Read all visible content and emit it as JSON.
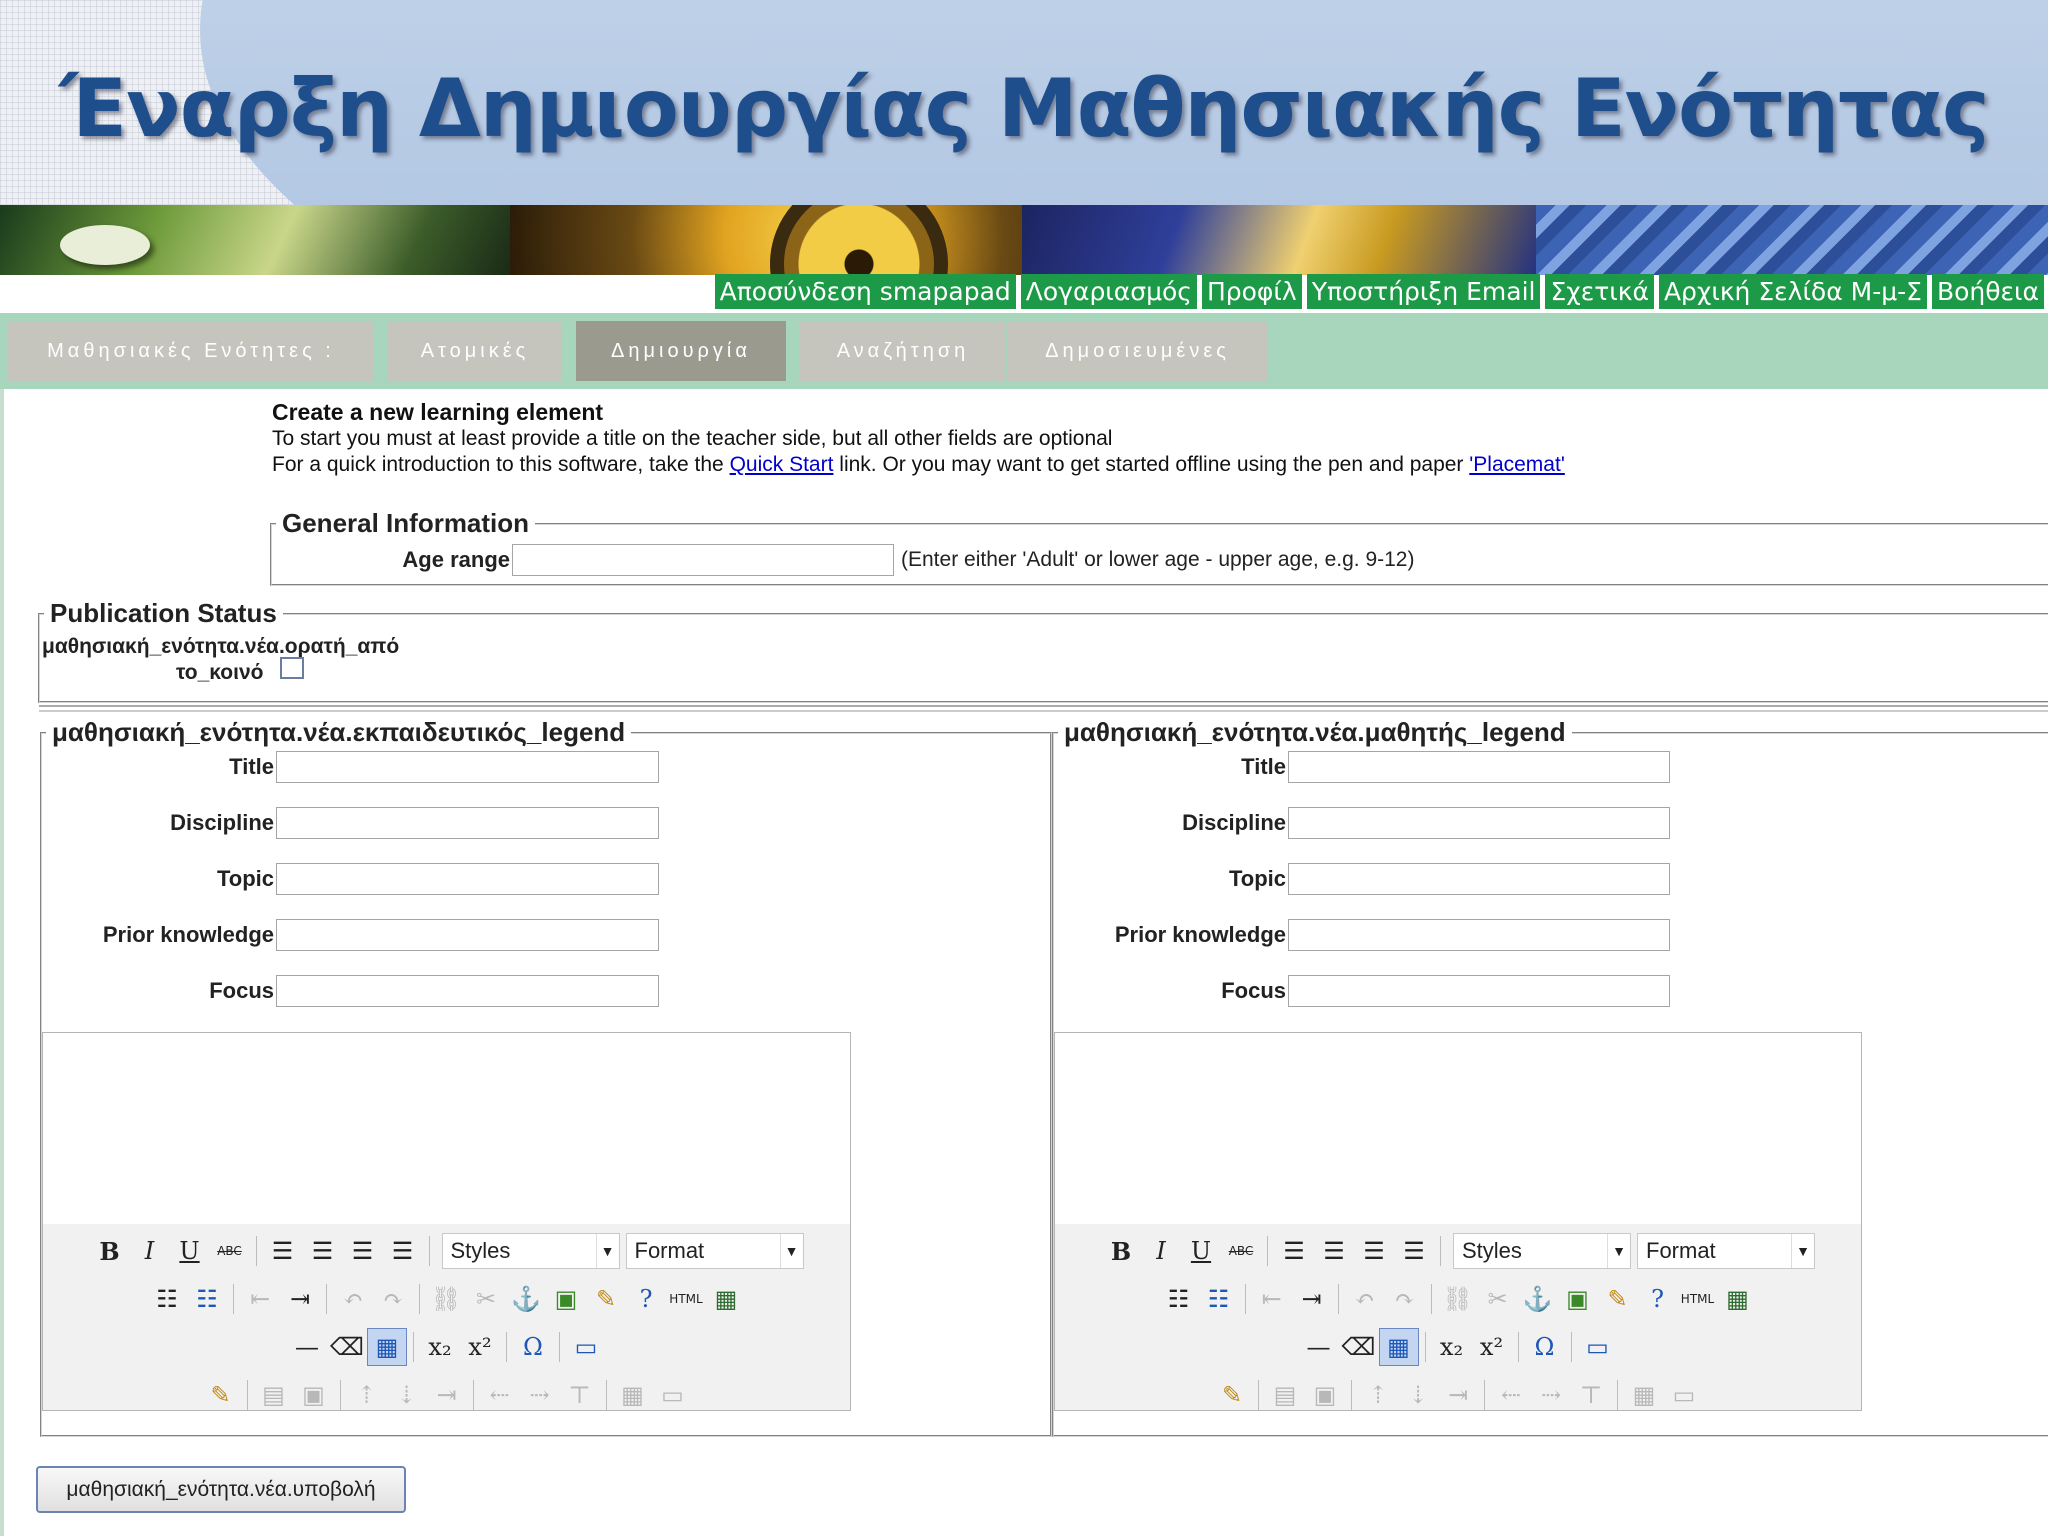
{
  "slide": {
    "title": "Έναρξη Δημιουργίας Μαθησιακής Ενότητας"
  },
  "toplinks": [
    "Αποσύνδεση smapapad",
    "Λογαριασμός",
    "Προφίλ",
    "Υποστήριξη Email",
    "Σχετικά",
    "Αρχική Σελίδα Μ-μ-Σ",
    "Βοήθεια"
  ],
  "tabs": [
    "Μαθησιακές Ενότητες :",
    "Ατομικές",
    "Δημιουργία",
    "Αναζήτηση",
    "Δημοσιευμένες"
  ],
  "active_tab": "Δημιουργία",
  "intro": {
    "heading": "Create a new learning element",
    "line1": "To start you must at least provide a title on the teacher side, but all other fields are optional",
    "line2_prefix": "For a quick introduction to this software, take the ",
    "quick_start_link": "Quick Start",
    "line2_middle": " link. Or you may want to get started offline using the pen and paper ",
    "placemat_link": "'Placemat'"
  },
  "general_information": {
    "legend": "General Information",
    "age_range_label": "Age range",
    "age_range_value": "",
    "age_range_hint": "(Enter either 'Adult' or lower age - upper age, e.g. 9-12)"
  },
  "publication_status": {
    "legend": "Publication Status",
    "note_line1": "μαθησιακή_ενότητα.νέα.ορατή_από",
    "note_line2": "το_κοινό",
    "checked": false
  },
  "teacher": {
    "legend": "μαθησιακή_ενότητα.νέα.εκπαιδευτικός_legend",
    "labels": {
      "title": "Title",
      "discipline": "Discipline",
      "topic": "Topic",
      "prior_knowledge": "Prior knowledge",
      "focus": "Focus"
    },
    "values": {
      "title": "",
      "discipline": "",
      "topic": "",
      "prior_knowledge": "",
      "focus": ""
    }
  },
  "student": {
    "legend": "μαθησιακή_ενότητα.νέα.μαθητής_legend",
    "labels": {
      "title": "Title",
      "discipline": "Discipline",
      "topic": "Topic",
      "prior_knowledge": "Prior knowledge",
      "focus": "Focus"
    },
    "values": {
      "title": "",
      "discipline": "",
      "topic": "",
      "prior_knowledge": "",
      "focus": ""
    }
  },
  "editor": {
    "styles_label": "Styles",
    "format_label": "Format",
    "html_label": "HTML",
    "icons": {
      "bold": "B",
      "italic": "I",
      "underline": "U",
      "strike": "ABC",
      "subscript": "x₂",
      "superscript": "x²",
      "omega": "Ω"
    }
  },
  "submit_label": "μαθησιακή_ενότητα.νέα.υποβολή"
}
